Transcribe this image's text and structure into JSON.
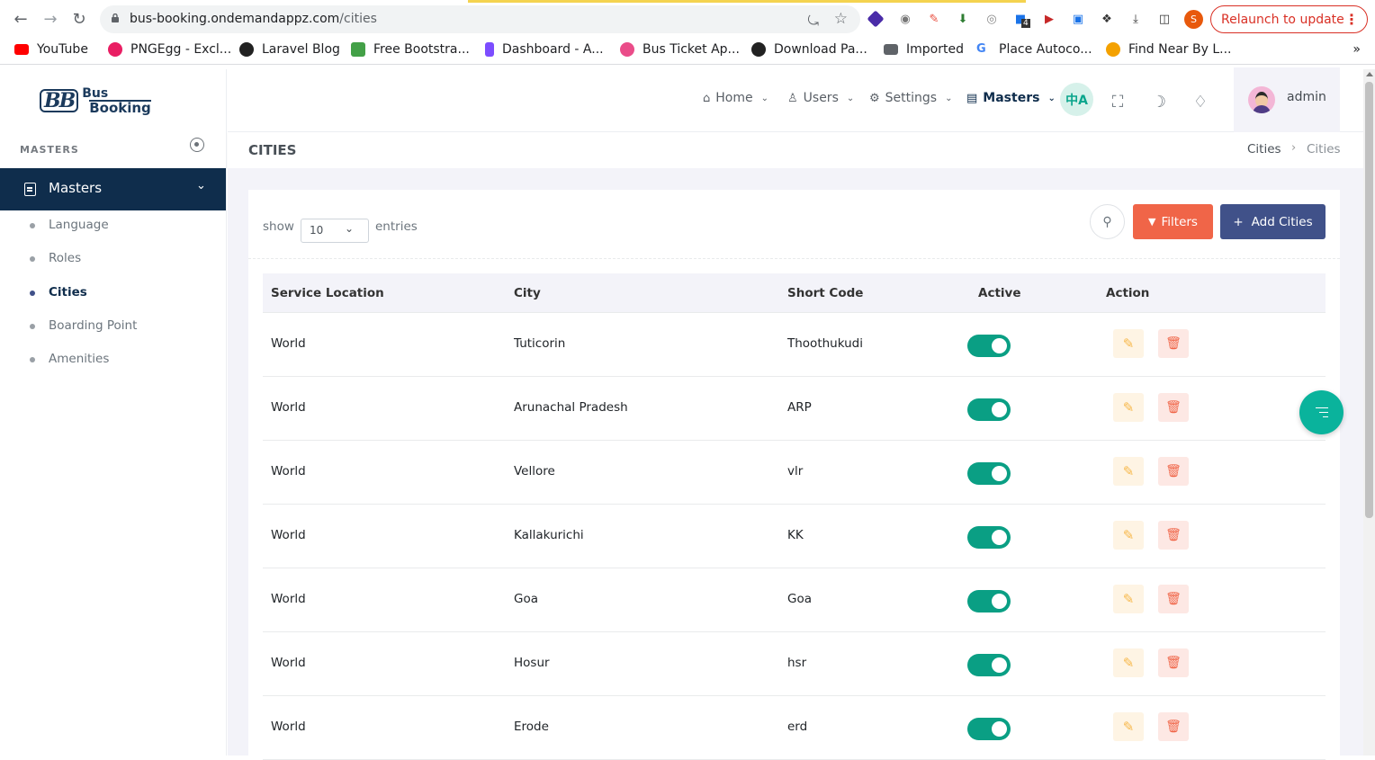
{
  "browser": {
    "url_host": "bus-booking.ondemandappz.com",
    "url_path": "/cities",
    "relaunch_label": "Relaunch to update",
    "profile_initial": "S",
    "ext_badge": "4",
    "bookmarks": [
      {
        "label": "YouTube",
        "color": "#ff0000"
      },
      {
        "label": "PNGEgg - Excl...",
        "color": "#e91e63"
      },
      {
        "label": "Laravel Blog",
        "color": "#222222"
      },
      {
        "label": "Free Bootstra...",
        "color": "#43a047"
      },
      {
        "label": "Dashboard - A...",
        "color": "#7c4dff"
      },
      {
        "label": "Bus Ticket Ap...",
        "color": "#ea4c89"
      },
      {
        "label": "Download Pa...",
        "color": "#222222"
      },
      {
        "label": "Imported",
        "color": "#5f6368"
      },
      {
        "label": "Place Autoco...",
        "color": "#4285f4"
      },
      {
        "label": "Find Near By L...",
        "color": "#f4a100"
      }
    ],
    "more_label": "»"
  },
  "app": {
    "logo_bb": "BB",
    "logo_line1": "Bus",
    "logo_line2": "Booking",
    "sidebar_header": "MASTERS",
    "sidebar_active": "Masters",
    "sidebar_items": [
      {
        "label": "Language",
        "active": false
      },
      {
        "label": "Roles",
        "active": false
      },
      {
        "label": "Cities",
        "active": true
      },
      {
        "label": "Boarding Point",
        "active": false
      },
      {
        "label": "Amenities",
        "active": false
      }
    ],
    "topnav": [
      {
        "label": "Home",
        "icon": "home-icon",
        "glyph": "⌂"
      },
      {
        "label": "Users",
        "icon": "user-icon",
        "glyph": "♙"
      },
      {
        "label": "Settings",
        "icon": "gear-icon",
        "glyph": "⚙"
      },
      {
        "label": "Masters",
        "icon": "document-icon",
        "glyph": "▤"
      }
    ],
    "lang_glyph": "中A",
    "user_name": "admin",
    "page_title": "CITIES",
    "breadcrumb": [
      "Cities",
      "Cities"
    ],
    "show_label": "show",
    "entries_value": "10",
    "entries_label": "entries",
    "filters_label": "Filters",
    "add_label": "Add Cities",
    "columns": [
      "Service Location",
      "City",
      "Short Code",
      "Active",
      "Action"
    ],
    "rows": [
      {
        "location": "World",
        "city": "Tuticorin",
        "code": "Thoothukudi",
        "active": true
      },
      {
        "location": "World",
        "city": "Arunachal Pradesh",
        "code": "ARP",
        "active": true
      },
      {
        "location": "World",
        "city": "Vellore",
        "code": "vlr",
        "active": true
      },
      {
        "location": "World",
        "city": "Kallakurichi",
        "code": "KK",
        "active": true
      },
      {
        "location": "World",
        "city": "Goa",
        "code": "Goa",
        "active": true
      },
      {
        "location": "World",
        "city": "Hosur",
        "code": "hsr",
        "active": true
      },
      {
        "location": "World",
        "city": "Erode",
        "code": "erd",
        "active": true
      }
    ],
    "colors": {
      "primary": "#0f2d4c",
      "accent": "#405189",
      "danger": "#f06548",
      "success": "#0a9f84",
      "warning": "#f7b84b"
    }
  }
}
